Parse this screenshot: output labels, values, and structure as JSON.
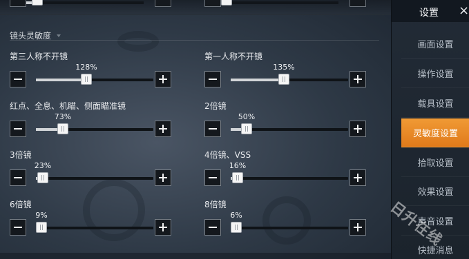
{
  "section": {
    "title": "镜头灵敏度"
  },
  "controls": [
    {
      "label": "第三人称不开镜",
      "percent": "128%",
      "level": 0.42
    },
    {
      "label": "第一人称不开镜",
      "percent": "135%",
      "level": 0.45
    },
    {
      "label": "红点、全息、机瞄、侧面瞄准镜",
      "percent": "73%",
      "level": 0.2
    },
    {
      "label": "2倍镜",
      "percent": "50%",
      "level": 0.1
    },
    {
      "label": "3倍镜",
      "percent": "23%",
      "level": 0.01
    },
    {
      "label": "4倍镜、VSS",
      "percent": "16%",
      "level": 0.01
    },
    {
      "label": "6倍镜",
      "percent": "9%",
      "level": 0.0
    },
    {
      "label": "8倍镜",
      "percent": "6%",
      "level": 0.0
    }
  ],
  "previous_row": [
    {
      "level": 0.05
    },
    {
      "level": 0.0
    }
  ],
  "sidebar": {
    "title": "设置",
    "close": "×",
    "items": [
      {
        "label": "画面设置",
        "active": false
      },
      {
        "label": "操作设置",
        "active": false
      },
      {
        "label": "载具设置",
        "active": false
      },
      {
        "label": "灵敏度设置",
        "active": true
      },
      {
        "label": "拾取设置",
        "active": false
      },
      {
        "label": "效果设置",
        "active": false
      },
      {
        "label": "声音设置",
        "active": false
      },
      {
        "label": "快捷消息",
        "active": false
      }
    ]
  },
  "watermark": "日升在线",
  "colors": {
    "accent": "#e8892a",
    "track": "#0f1317",
    "fill": "#d2d5d8"
  },
  "icons": {
    "minus": "minus-icon",
    "plus": "plus-icon",
    "close": "close-icon"
  }
}
